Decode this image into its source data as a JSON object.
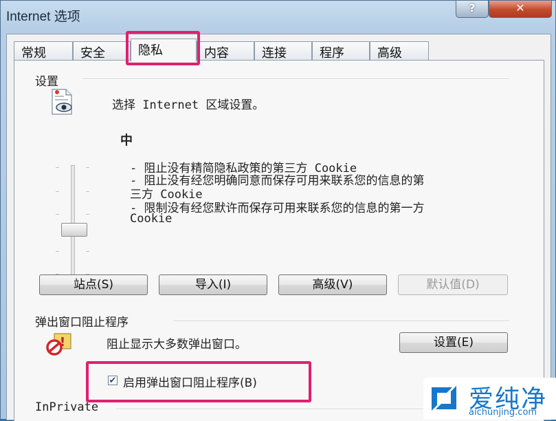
{
  "window": {
    "title": "Internet 选项",
    "help_label": "?",
    "close_label": "✕"
  },
  "tabs": [
    {
      "label": "常规"
    },
    {
      "label": "安全"
    },
    {
      "label": "隐私",
      "active": true
    },
    {
      "label": "内容"
    },
    {
      "label": "连接"
    },
    {
      "label": "程序"
    },
    {
      "label": "高级"
    }
  ],
  "settings": {
    "group_label": "设置",
    "zone_text": "选择 Internet 区域设置。",
    "level_title": "中",
    "level_lines": [
      "- 阻止没有精简隐私政策的第三方 Cookie",
      "- 阻止没有经您明确同意而保存可用来联系您的信息的第",
      "三方 Cookie",
      "- 限制没有经您默许而保存可用来联系您的信息的第一方",
      "Cookie"
    ],
    "buttons": {
      "sites": "站点(S)",
      "import": "导入(I)",
      "advanced": "高级(V)",
      "default": "默认值(D)"
    }
  },
  "popup": {
    "group_label": "弹出窗口阻止程序",
    "description": "阻止显示大多数弹出窗口。",
    "settings_button": "设置(E)",
    "enable_checkbox_label": "启用弹出窗口阻止程序(B)",
    "enable_checked": true
  },
  "inprivate": {
    "group_label": "InPrivate"
  },
  "watermark": {
    "title": "爱纯净",
    "url": "aichunjing.com"
  },
  "colors": {
    "highlight": "#e0206e",
    "watermark_blue": "#1877c9"
  }
}
